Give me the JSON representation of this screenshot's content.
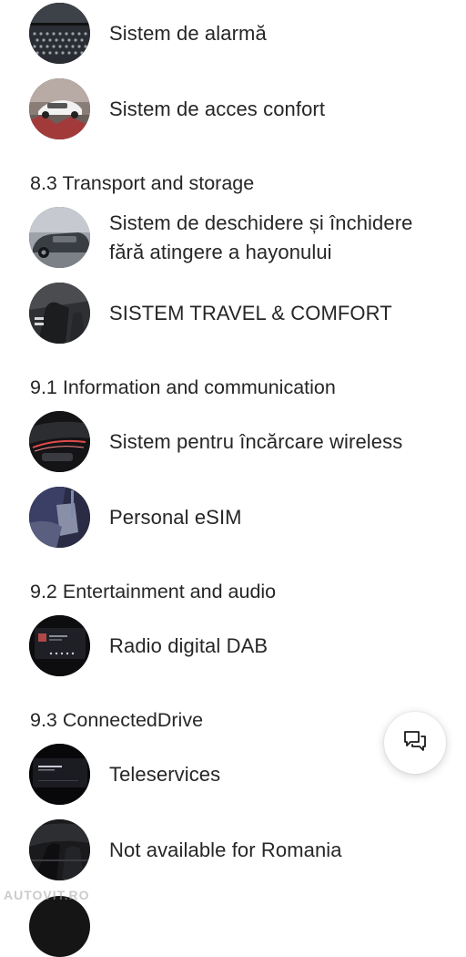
{
  "features_top": [
    {
      "label": "Sistem de alarmă"
    },
    {
      "label": "Sistem de acces confort"
    }
  ],
  "sections": [
    {
      "heading": "8.3 Transport and storage",
      "items": [
        {
          "label": "Sistem de deschidere și închidere fără atingere a hayonului"
        },
        {
          "label": "SISTEM TRAVEL & COMFORT"
        }
      ]
    },
    {
      "heading": "9.1 Information and communication",
      "items": [
        {
          "label": "Sistem pentru încărcare wireless"
        },
        {
          "label": "Personal eSIM"
        }
      ]
    },
    {
      "heading": "9.2 Entertainment and audio",
      "items": [
        {
          "label": "Radio digital DAB"
        }
      ]
    },
    {
      "heading": "9.3 ConnectedDrive",
      "items": [
        {
          "label": "Teleservices"
        },
        {
          "label": "Not available for Romania"
        }
      ]
    }
  ],
  "chat_button": {
    "icon": "chat-bubbles-icon"
  },
  "watermark": "AUTOVIT.RO",
  "colors": {
    "text": "#262626",
    "background": "#ffffff"
  }
}
